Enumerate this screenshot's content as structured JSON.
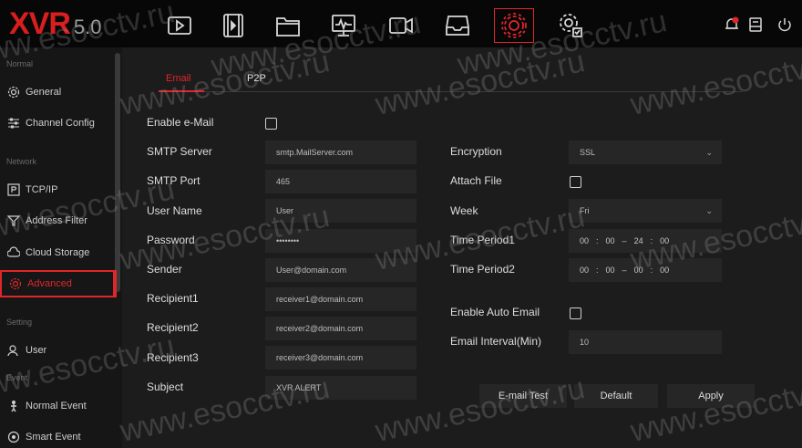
{
  "app": {
    "logo": "XVR",
    "version": "5.0"
  },
  "topbar": {
    "icons": [
      "playback-icon",
      "film-icon",
      "folder-icon",
      "monitor-icon",
      "camera-icon",
      "storage-icon",
      "settings-icon",
      "system-settings-icon"
    ],
    "active_icon": "settings-icon"
  },
  "sidebar": {
    "sections": {
      "normal": "Normal",
      "network": "Network",
      "setting": "Setting",
      "event": "Event"
    },
    "items": [
      {
        "label": "General",
        "icon": "gear-icon"
      },
      {
        "label": "Channel Config",
        "icon": "sliders-icon"
      },
      {
        "label": "TCP/IP",
        "icon": "network-port-icon"
      },
      {
        "label": "Address Filter",
        "icon": "filter-icon"
      },
      {
        "label": "Cloud Storage",
        "icon": "cloud-icon"
      },
      {
        "label": "Advanced",
        "icon": "advanced-gear-icon"
      },
      {
        "label": "User",
        "icon": "user-icon"
      },
      {
        "label": "Normal Event",
        "icon": "person-icon"
      },
      {
        "label": "Smart Event",
        "icon": "smart-event-icon"
      }
    ],
    "active": "Advanced"
  },
  "tabs": [
    {
      "label": "Email",
      "active": true
    },
    {
      "label": "P2P",
      "active": false
    }
  ],
  "form": {
    "enable_email": {
      "label": "Enable e-Mail",
      "checked": false
    },
    "smtp_server": {
      "label": "SMTP Server",
      "value": "smtp.MailServer.com"
    },
    "smtp_port": {
      "label": "SMTP Port",
      "value": "465"
    },
    "user_name": {
      "label": "User Name",
      "value": "User"
    },
    "password": {
      "label": "Password",
      "value": "••••••••"
    },
    "sender": {
      "label": "Sender",
      "value": "User@domain.com"
    },
    "recipient1": {
      "label": "Recipient1",
      "value": "receiver1@domain.com"
    },
    "recipient2": {
      "label": "Recipient2",
      "value": "receiver2@domain.com"
    },
    "recipient3": {
      "label": "Recipient3",
      "value": "receiver3@domain.com"
    },
    "subject": {
      "label": "Subject",
      "value": "XVR ALERT"
    },
    "encryption": {
      "label": "Encryption",
      "value": "SSL"
    },
    "attach_file": {
      "label": "Attach File",
      "checked": false
    },
    "week": {
      "label": "Week",
      "value": "Fri"
    },
    "time_period1": {
      "label": "Time Period1",
      "start_h": "00",
      "start_m": "00",
      "end_h": "24",
      "end_m": "00"
    },
    "time_period2": {
      "label": "Time Period2",
      "start_h": "00",
      "start_m": "00",
      "end_h": "00",
      "end_m": "00"
    },
    "enable_auto_email": {
      "label": "Enable Auto Email",
      "checked": false
    },
    "email_interval": {
      "label": "Email Interval(Min)",
      "value": "10"
    }
  },
  "buttons": {
    "email_test": "E-mail Test",
    "default": "Default",
    "apply": "Apply"
  },
  "time_sep": {
    "colon": ":",
    "dash": "–"
  },
  "watermark": "www.esocctv.ru",
  "colors": {
    "accent": "#e0262a",
    "panel": "#1c1c1c",
    "field": "#262626"
  }
}
